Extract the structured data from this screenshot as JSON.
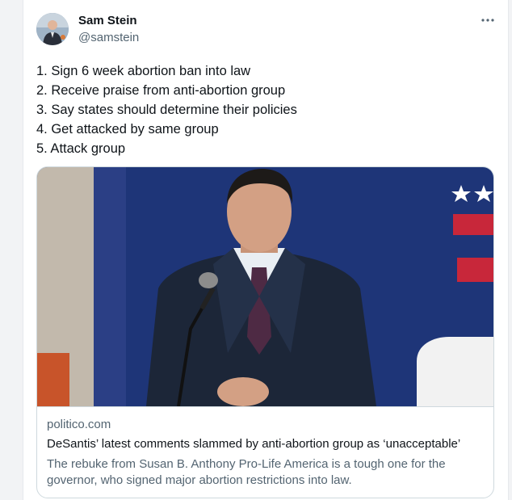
{
  "author": {
    "name": "Sam Stein",
    "handle": "@samstein"
  },
  "tweet": {
    "lines": [
      "1. Sign 6 week abortion ban into law",
      "2. Receive praise from anti-abortion group",
      "3. Say states should determine their policies",
      "4. Get attacked by same group",
      "5. Attack group"
    ]
  },
  "link_card": {
    "domain": "politico.com",
    "title": "DeSantis’ latest comments slammed by anti-abortion group as ‘unacceptable’",
    "description": "The rebuke from Susan B. Anthony Pro-Life America is a tough one for the governor, who signed major abortion restrictions into law."
  },
  "icons": {
    "more": "more-horizontal-icon"
  },
  "colors": {
    "text_primary": "#0f1419",
    "text_secondary": "#536471",
    "border": "#cfd9de"
  }
}
